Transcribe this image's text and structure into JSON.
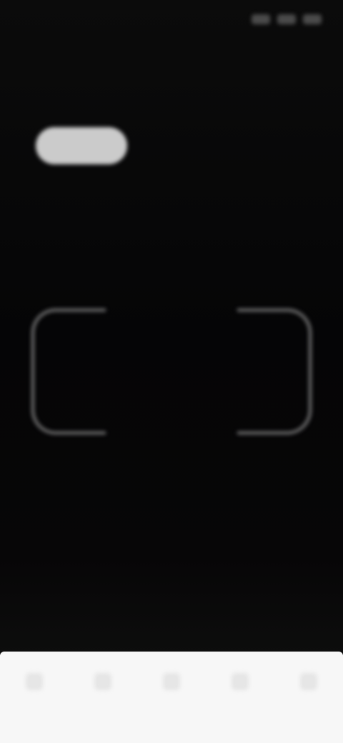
{
  "status_bar": {
    "time": "",
    "icons": [
      "signal-icon",
      "wifi-icon",
      "battery-icon"
    ]
  },
  "header": {
    "title": ""
  },
  "mode_tabs": [
    {
      "label": "",
      "active": true
    },
    {
      "label": "",
      "active": false
    },
    {
      "label": "",
      "active": false
    }
  ],
  "scan": {
    "hint": ""
  },
  "bottom_nav": {
    "items": [
      {
        "label": "",
        "icon": "home-icon"
      },
      {
        "label": "",
        "icon": "discover-icon"
      },
      {
        "label": "",
        "icon": "scan-icon"
      },
      {
        "label": "",
        "icon": "messages-icon"
      },
      {
        "label": "",
        "icon": "profile-icon"
      }
    ]
  },
  "colors": {
    "background": "#050505",
    "active_tab": "#d6d6d6",
    "frame": "#8c8c8c",
    "sheet": "#f7f7f7"
  }
}
